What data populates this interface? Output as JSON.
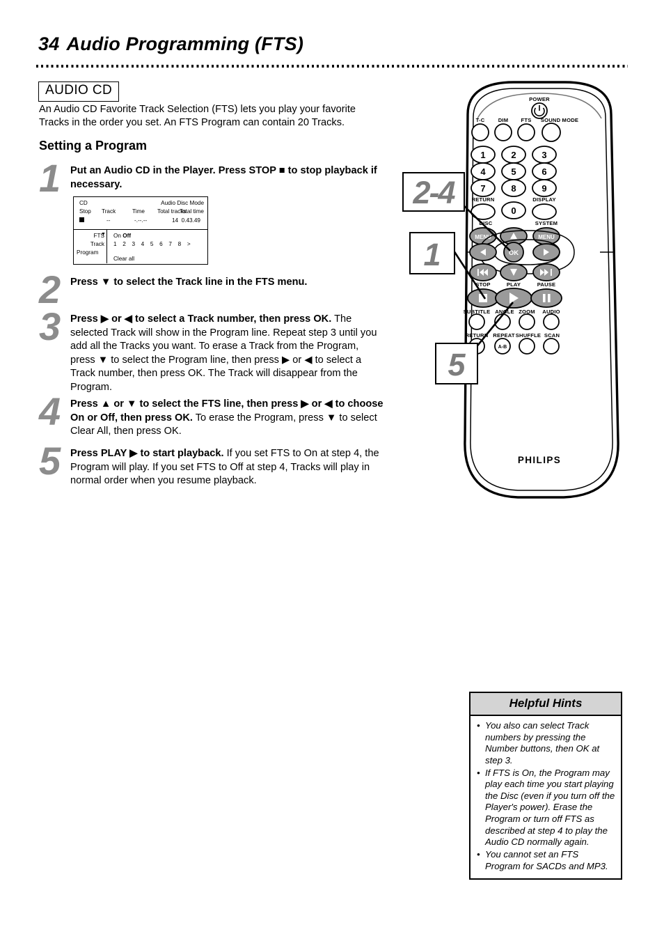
{
  "page": {
    "number": "34",
    "title": "Audio Programming (FTS)"
  },
  "badge": {
    "label": "AUDIO CD"
  },
  "intro": "An Audio CD Favorite Track Selection (FTS) lets you play your favorite Tracks in the order you set. An FTS Program can contain 20 Tracks.",
  "section": {
    "heading": "Setting a Program"
  },
  "steps": [
    {
      "number": "1",
      "bold": "Put an Audio CD in the Player. Press STOP ■ to stop playback if necessary.",
      "rest": ""
    },
    {
      "number": "2",
      "bold": "Press ▼ to select the Track line in the FTS menu.",
      "rest": ""
    },
    {
      "number": "3",
      "bold": "Press ▶ or ◀ to select a Track number, then press OK.",
      "rest": " The selected Track will show in the Program line. Repeat step 3 until you add all the Tracks you want. To erase a Track from the Program, press ▼ to select the Program line, then press ▶ or ◀ to select a Track number, then press OK. The Track will disappear from the Program."
    },
    {
      "number": "4",
      "bold": "Press ▲ or ▼ to select the FTS line, then press ▶ or ◀ to choose On or Off, then press OK.",
      "rest": " To erase the Program, press ▼ to select Clear All, then press OK."
    },
    {
      "number": "5",
      "bold": "Press PLAY ▶ to start playback.",
      "rest": " If you set FTS to On at step 4, the Program will play. If you set FTS to Off at step 4, Tracks will play in normal order when you resume playback."
    }
  ],
  "cd_display": {
    "disc_type": "CD",
    "mode": "Audio Disc Mode",
    "headers": {
      "state": "Stop",
      "track": "Track",
      "time": "Time",
      "total_tracks": "Total tracks",
      "total_time": "Total time"
    },
    "values": {
      "track": "--",
      "time": "-.--.--",
      "total_tracks": "14",
      "total_time": "0.43.49"
    },
    "menu": {
      "fts_label": "FTS",
      "fts_caret": "▼",
      "fts_on": "On",
      "fts_off": "Off",
      "track_label": "Track",
      "track_numbers": "1 2 3 4 5 6 7 8 >",
      "program_label": "Program",
      "clear_all": "Clear all"
    }
  },
  "remote": {
    "brand": "PHILIPS",
    "power_label": "POWER",
    "function_row": [
      "T-C",
      "DIM",
      "FTS",
      "SOUND MODE"
    ],
    "numpad": [
      "1",
      "2",
      "3",
      "4",
      "5",
      "6",
      "7",
      "8",
      "9",
      "0"
    ],
    "return_label": "RETURN",
    "display_label": "DISPLAY",
    "disc_label": "DISC",
    "system_label": "SYSTEM",
    "menu_label": "MENU",
    "ok_label": "OK",
    "transport_labels": [
      "STOP",
      "PLAY",
      "PAUSE"
    ],
    "feature_row_1": [
      "SUBTITLE",
      "ANGLE",
      "ZOOM",
      "AUDIO"
    ],
    "feature_row_2": [
      "RETURN",
      "REPEAT",
      "SHUFFLE",
      "SCAN"
    ],
    "repeat_ab": "A-B"
  },
  "callouts": [
    {
      "label": "2-4"
    },
    {
      "label": "1"
    },
    {
      "label": "5"
    }
  ],
  "hints": {
    "title": "Helpful Hints",
    "items": [
      "You also can select Track numbers by pressing the Number buttons, then OK at step 3.",
      "If FTS is On, the Program may play each time you start playing the Disc (even if you turn off the Player's power). Erase the Program or turn off FTS as described at step 4 to play the Audio CD normally again.",
      "You cannot set an FTS Program for SACDs and MP3."
    ]
  },
  "colors": {
    "callout_number": "#7d7d7d",
    "step_number": "#8c8c8c",
    "hints_header_bg": "#d4d4d4",
    "button_fill": "#9a9a9a"
  }
}
